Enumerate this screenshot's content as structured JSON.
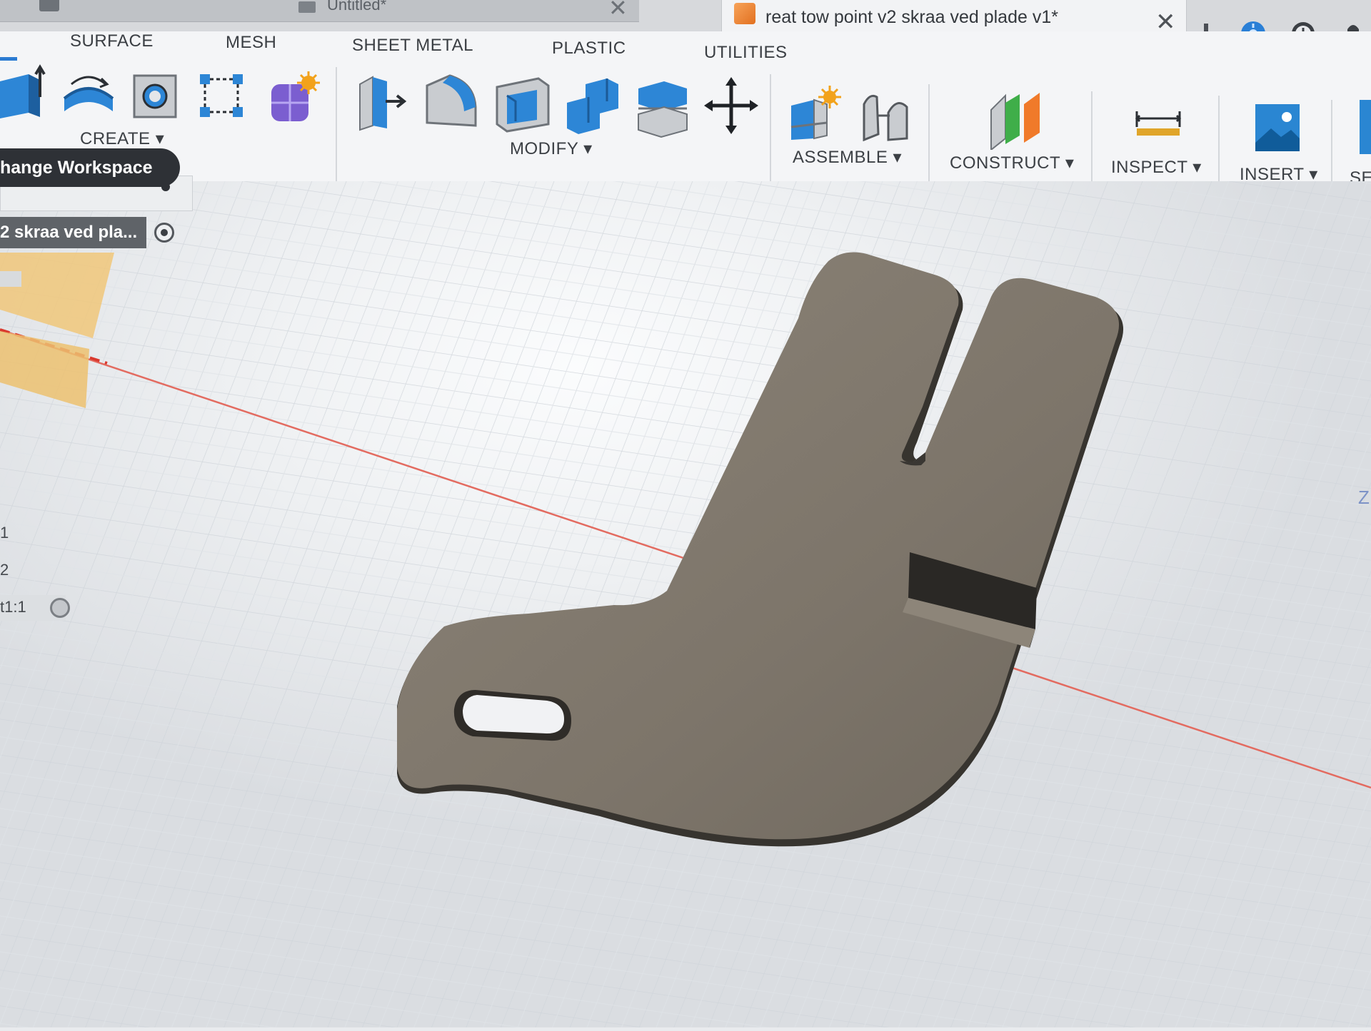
{
  "tabs": {
    "inactive_title": "Untitled*",
    "active_title": "reat tow point v2 skraa ved plade v1*",
    "close_glyph": "✕",
    "tools": [
      "plus-icon",
      "extensions-icon",
      "job-status-icon",
      "notifications-icon"
    ]
  },
  "workspaces": [
    "SURFACE",
    "MESH",
    "SHEET METAL",
    "PLASTIC",
    "UTILITIES"
  ],
  "groups": {
    "create": "CREATE ▾",
    "modify": "MODIFY ▾",
    "assemble": "ASSEMBLE ▾",
    "construct": "CONSTRUCT ▾",
    "inspect": "INSPECT ▾",
    "insert": "INSERT ▾",
    "select": "SE"
  },
  "tooltip": "hange Workspace",
  "browser": {
    "component_label": "2 skraa ved pla...",
    "row_1": "1",
    "row_2": "2",
    "row_3": "t1:1"
  },
  "viewport": {
    "axis_label": "Z",
    "colors": {
      "part_face": "#8f8678",
      "part_edge": "#3a3733",
      "grid": "#c9ced6",
      "x_axis": "#e06a5e"
    }
  }
}
